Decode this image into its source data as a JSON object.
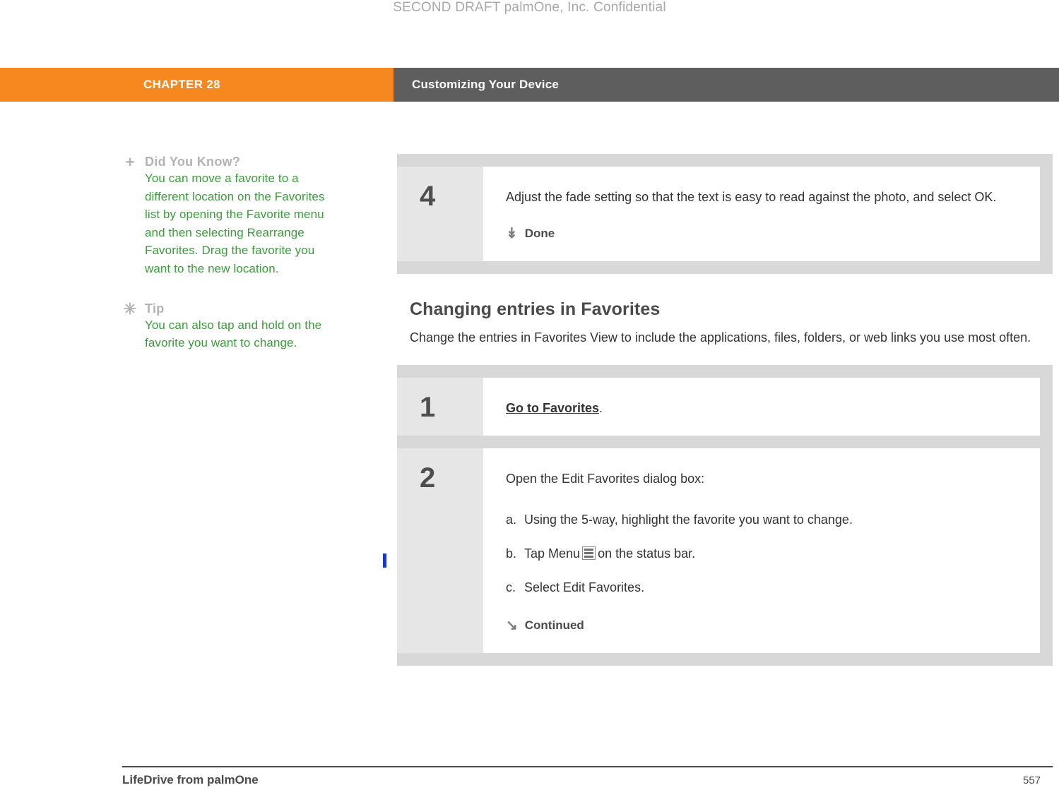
{
  "draft_header": "SECOND DRAFT palmOne, Inc.  Confidential",
  "chapter_bar": {
    "chapter_label": "CHAPTER 28",
    "section_label": "Customizing Your Device"
  },
  "notes": [
    {
      "marker": "+",
      "title": "Did You Know?",
      "body": "You can move a favorite to a different location on the Favorites list by opening the Favorite menu and then selecting Rearrange Favorites. Drag the favorite you want to the new location."
    },
    {
      "marker": "✳",
      "title": "Tip",
      "body": "You can also tap and hold on the favorite you want to change."
    }
  ],
  "top_steps": [
    {
      "number": "4",
      "text": "Adjust the fade setting so that the text is easy to read against the photo, and select OK.",
      "tag_icon": "down-arrow-icon",
      "tag_label": "Done"
    }
  ],
  "section": {
    "heading": "Changing entries in Favorites",
    "paragraph": "Change the entries in Favorites View to include the applications, files, folders, or web links you use most often."
  },
  "bottom_steps": [
    {
      "number": "1",
      "link_text": "Go to Favorites",
      "after_link": "."
    },
    {
      "number": "2",
      "intro": "Open the Edit Favorites dialog box:",
      "substeps": [
        {
          "label": "a.",
          "text": "Using the 5-way, highlight the favorite you want to change."
        },
        {
          "label": "b.",
          "text_before": "Tap Menu",
          "icon": "menu-icon",
          "text_after": "on the status bar."
        },
        {
          "label": "c.",
          "text": "Select Edit Favorites."
        }
      ],
      "tag_icon": "continued-arrow-icon",
      "tag_label": "Continued"
    }
  ],
  "footer": {
    "left": "LifeDrive from palmOne",
    "page_number": "557"
  }
}
